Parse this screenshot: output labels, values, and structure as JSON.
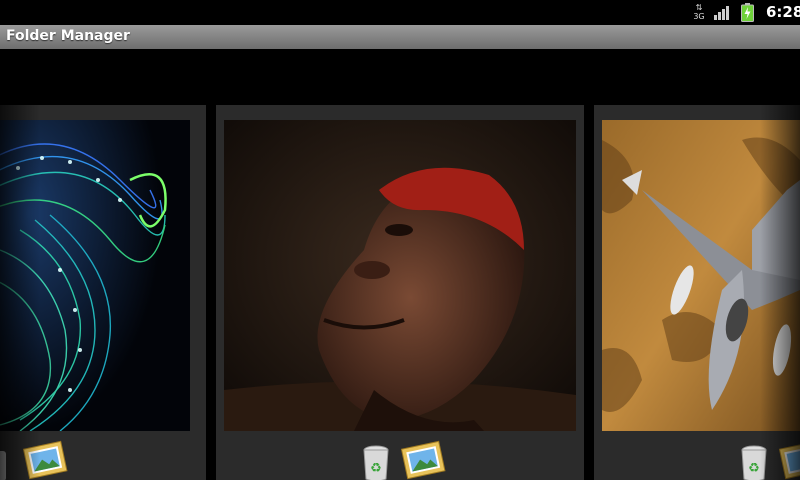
{
  "status_bar": {
    "network_type": "3G",
    "time": "6:28",
    "icons": [
      "network-3g-icon",
      "signal-strength-icon",
      "battery-charging-icon"
    ],
    "battery_color": "#6fd23a"
  },
  "app": {
    "title": "Folder Manager"
  },
  "gallery": {
    "cards": [
      {
        "subject": "fractal-spiral-image",
        "actions": [
          "trash-icon",
          "image-viewer-icon"
        ]
      },
      {
        "subject": "portrait-painting-image",
        "actions": [
          "trash-icon",
          "image-viewer-icon"
        ]
      },
      {
        "subject": "fighter-jet-image",
        "actions": [
          "trash-icon",
          "image-viewer-icon"
        ]
      }
    ]
  },
  "colors": {
    "background": "#000000",
    "card": "#2b2b2b",
    "title_bar": "#808080",
    "recycle_green": "#3aa43a"
  }
}
